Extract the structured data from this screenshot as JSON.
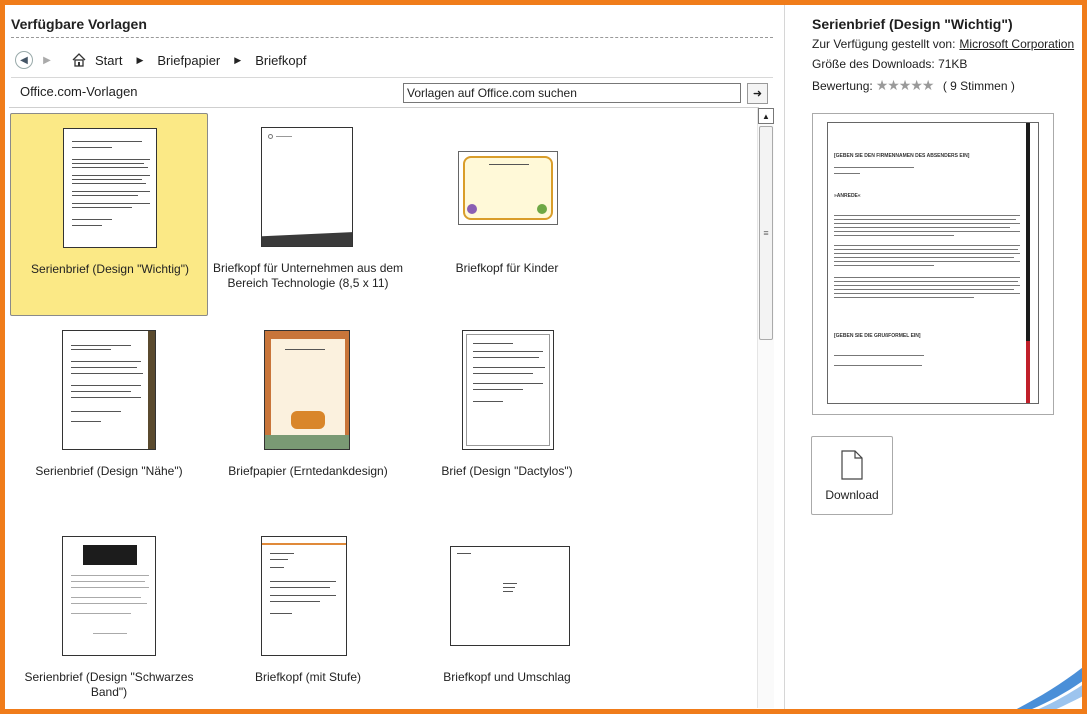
{
  "left": {
    "title": "Verfügbare Vorlagen",
    "breadcrumb": [
      "Start",
      "Briefpapier",
      "Briefkopf"
    ],
    "source_title": "Office.com-Vorlagen",
    "search_placeholder": "Vorlagen auf Office.com suchen"
  },
  "templates": [
    {
      "label": "Serienbrief (Design \"Wichtig\")",
      "selected": true
    },
    {
      "label": "Briefkopf für Unternehmen aus dem Bereich Technologie (8,5 x 11)"
    },
    {
      "label": "Briefkopf für Kinder"
    },
    {
      "label": "Serienbrief (Design \"Nähe\")"
    },
    {
      "label": "Briefpapier (Erntedankdesign)"
    },
    {
      "label": "Brief (Design \"Dactylos\")"
    },
    {
      "label": "Serienbrief (Design \"Schwarzes Band\")"
    },
    {
      "label": "Briefkopf (mit Stufe)"
    },
    {
      "label": "Briefkopf und Umschlag"
    }
  ],
  "right": {
    "title": "Serienbrief (Design \"Wichtig\")",
    "provided_by_label": "Zur Verfügung gestellt von:",
    "provided_by": "Microsoft Corporation",
    "download_size_label": "Größe des Downloads:",
    "download_size": "71KB",
    "rating_label": "Bewertung:",
    "rating_stars": "★★★★★",
    "rating_votes": "( 9 Stimmen )",
    "preview_lines": [
      "[GEBEN SIE DEN FIRMENNAMEN DES ABSENDERS EIN]",
      "»ANREDE«",
      "[GEBEN SIE DIE GRUßFORMEL EIN]"
    ],
    "download_label": "Download"
  },
  "colors": {
    "frame": "#f07c1a",
    "selected": "#fbe986",
    "accent_bar": "#c0202a"
  }
}
